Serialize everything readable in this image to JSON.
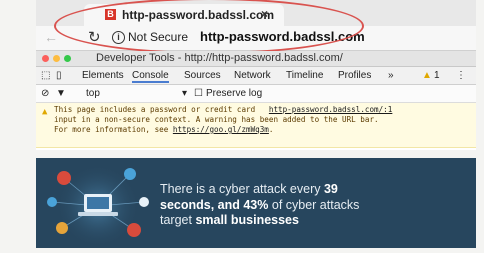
{
  "browser": {
    "tab": {
      "favicon_letter": "B",
      "title": "http-password.badssl.com",
      "close_glyph": "×"
    },
    "address": {
      "back_glyph": "←",
      "reload_glyph": "↻",
      "info_glyph": "i",
      "security_label": "Not Secure",
      "url": "http-password.badssl.com"
    }
  },
  "devtools": {
    "window_title": "Developer Tools - http://http-password.badssl.com/",
    "tabs": [
      "Elements",
      "Console",
      "Sources",
      "Network",
      "Timeline",
      "Profiles"
    ],
    "active_tab": "Console",
    "more_glyph": "»",
    "warning_count": "1",
    "menu_glyph": "⋮",
    "filter": {
      "context": "top",
      "preserve_log": "Preserve log"
    },
    "warning": {
      "line1": "This page includes a password or credit card",
      "line1_link": "http-password.badssl.com/:1",
      "line2": "input in a non-secure context. A warning has been added to the URL bar.",
      "line3": "For more information, see",
      "line3_link": "https://goo.gl/zmWq3m",
      "line3_end": "."
    }
  },
  "banner": {
    "part1": "There is a cyber attack every ",
    "num1": "39",
    "part2": "seconds, and ",
    "num2": "43%",
    "part3": " of cyber attacks",
    "part4": "target ",
    "emph": "small businesses"
  },
  "colors": {
    "tab_favicon": "#d8352a",
    "highlight": "#d9534f",
    "banner_bg": "#27465e",
    "warning_bg": "#fffbe1"
  }
}
